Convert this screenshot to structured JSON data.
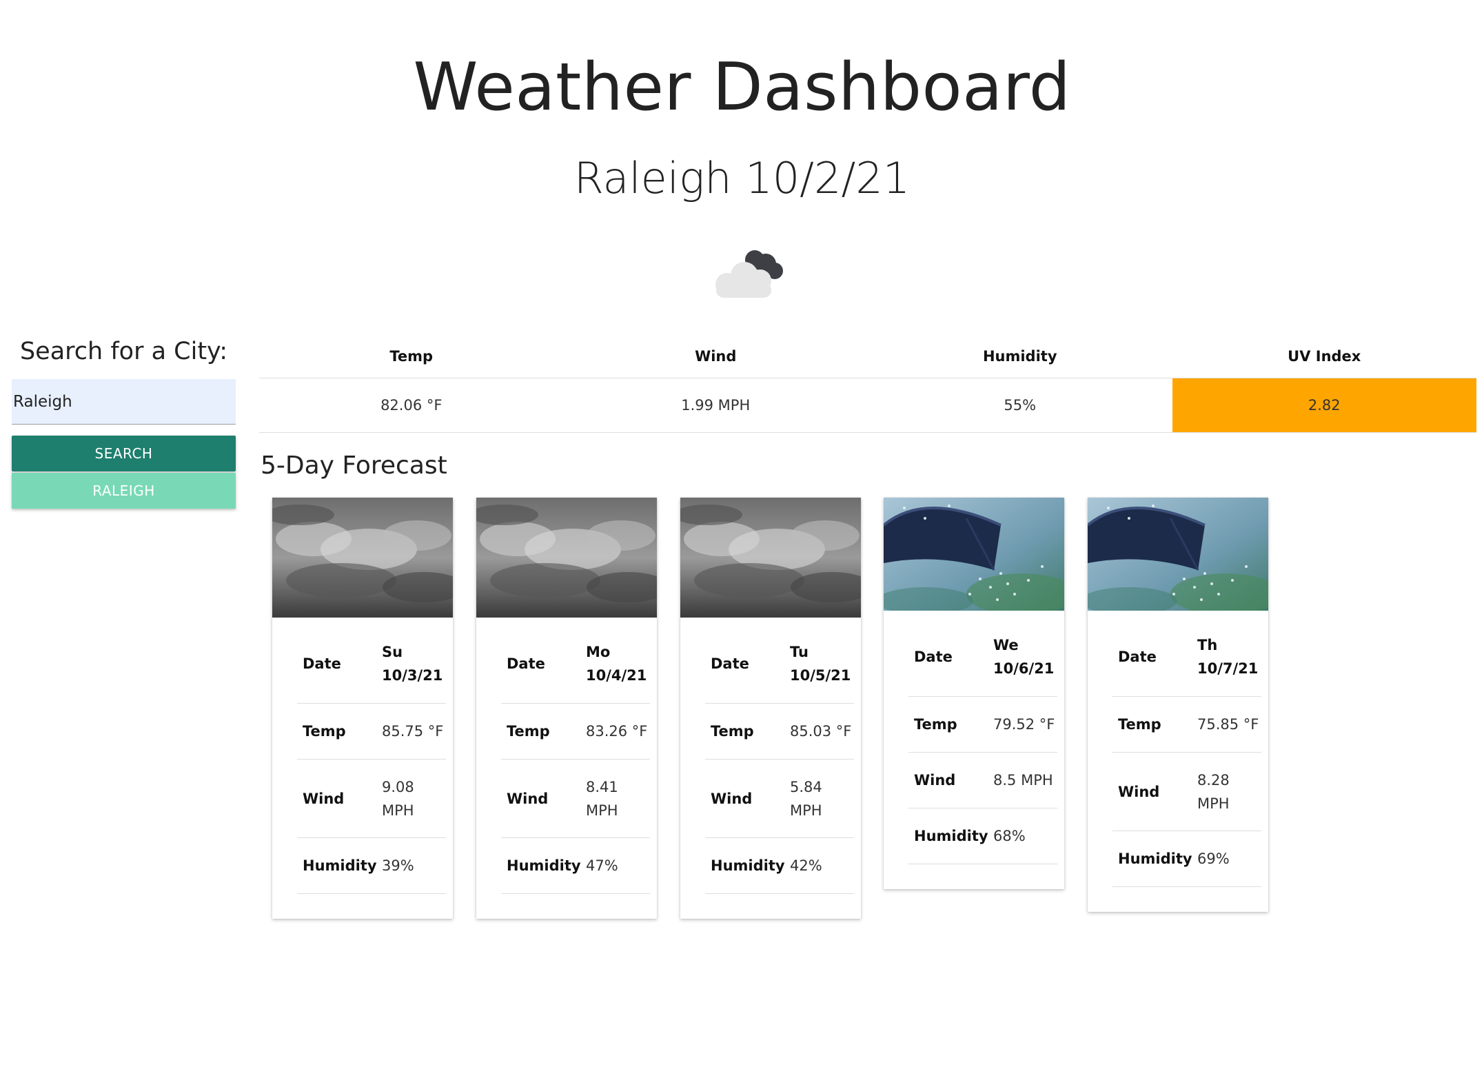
{
  "header": {
    "title": "Weather Dashboard",
    "subtitle": "Raleigh 10/2/21",
    "icon": "cloudy-icon"
  },
  "sidebar": {
    "search_label": "Search for a City:",
    "search_value": "Raleigh",
    "search_button": "SEARCH",
    "history": [
      "RALEIGH"
    ]
  },
  "current": {
    "headers": [
      "Temp",
      "Wind",
      "Humidity",
      "UV Index"
    ],
    "values": [
      "82.06 °F",
      "1.99 MPH",
      "55%",
      "2.82"
    ],
    "uv_color": "#ffa500"
  },
  "forecast": {
    "label": "5-Day Forecast",
    "row_labels": {
      "date": "Date",
      "temp": "Temp",
      "wind": "Wind",
      "humidity": "Humidity"
    },
    "days": [
      {
        "day": "Su",
        "date": "10/3/21",
        "temp": "85.75 °F",
        "wind_value": "9.08",
        "wind_unit": "MPH",
        "humidity": "39%",
        "image": "cloudy"
      },
      {
        "day": "Mo",
        "date": "10/4/21",
        "temp": "83.26 °F",
        "wind_value": "8.41",
        "wind_unit": "MPH",
        "humidity": "47%",
        "image": "cloudy"
      },
      {
        "day": "Tu",
        "date": "10/5/21",
        "temp": "85.03 °F",
        "wind_value": "5.84",
        "wind_unit": "MPH",
        "humidity": "42%",
        "image": "cloudy"
      },
      {
        "day": "We",
        "date": "10/6/21",
        "temp": "79.52 °F",
        "wind_value": "8.5 MPH",
        "wind_unit": "",
        "humidity": "68%",
        "image": "rain"
      },
      {
        "day": "Th",
        "date": "10/7/21",
        "temp": "75.85 °F",
        "wind_value": "8.28",
        "wind_unit": "MPH",
        "humidity": "69%",
        "image": "rain"
      }
    ]
  }
}
